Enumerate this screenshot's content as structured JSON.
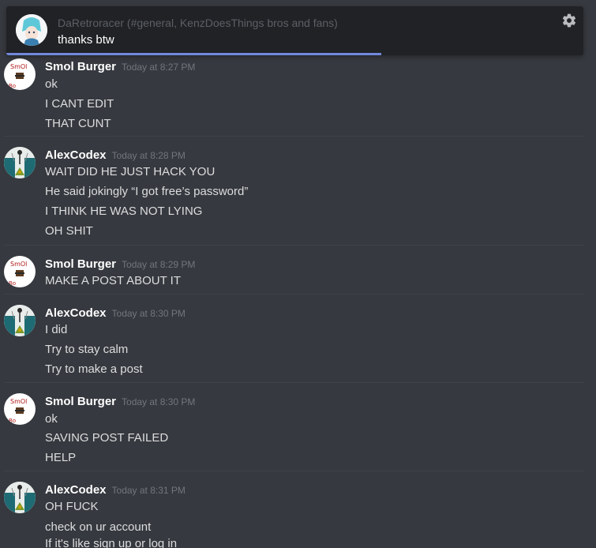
{
  "notification": {
    "header": "DaRetroracer (#general, KenzDoesThings bros and fans)",
    "text": "thanks btw",
    "progress": 0.65,
    "settings_icon": "gear-icon"
  },
  "messages": [
    {
      "author": "Smol Burger",
      "timestamp": "Today at 8:27 PM",
      "avatar": "smol-burger-avatar",
      "lines": [
        "ok",
        "I CANT EDIT",
        "THAT CUNT"
      ]
    },
    {
      "author": "AlexCodex",
      "timestamp": "Today at 8:28 PM",
      "avatar": "alexcodex-avatar",
      "lines": [
        "WAIT DID HE JUST HACK YOU",
        "He said jokingly “I got free’s password”",
        "I THINK HE WAS NOT LYING",
        "OH SHIT"
      ]
    },
    {
      "author": "Smol Burger",
      "timestamp": "Today at 8:29 PM",
      "avatar": "smol-burger-avatar",
      "lines": [
        "MAKE A POST ABOUT IT"
      ]
    },
    {
      "author": "AlexCodex",
      "timestamp": "Today at 8:30 PM",
      "avatar": "alexcodex-avatar",
      "lines": [
        "I did",
        "Try to stay calm",
        "Try to make a post"
      ]
    },
    {
      "author": "Smol Burger",
      "timestamp": "Today at 8:30 PM",
      "avatar": "smol-burger-avatar",
      "lines": [
        "ok",
        "SAVING POST FAILED",
        "HELP"
      ]
    },
    {
      "author": "AlexCodex",
      "timestamp": "Today at 8:31 PM",
      "avatar": "alexcodex-avatar",
      "lines": [
        "OH FUCK",
        "check on ur account",
        "If it's like sign up or log in"
      ]
    }
  ],
  "colors": {
    "background": "#36393f",
    "toast": "#202225",
    "accent": "#7289da",
    "username": "#ffffff",
    "message": "#dcddde",
    "timestamp": "#72767d"
  }
}
